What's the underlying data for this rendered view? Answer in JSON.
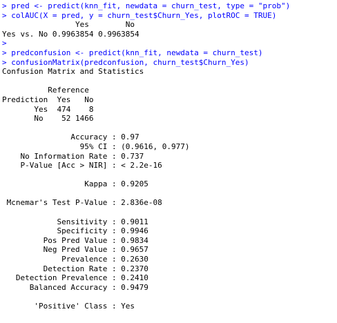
{
  "colors": {
    "command": "#0000ff",
    "output": "#000000",
    "background": "#ffffff"
  },
  "lines": [
    {
      "kind": "cmd",
      "text": "> pred <- predict(knn_fit, newdata = churn_test, type = \"prob\")"
    },
    {
      "kind": "cmd",
      "text": "> colAUC(X = pred, y = churn_test$Churn_Yes, plotROC = TRUE)"
    },
    {
      "kind": "out",
      "text": "                Yes        No"
    },
    {
      "kind": "out",
      "text": "Yes vs. No 0.9963854 0.9963854"
    },
    {
      "kind": "cmd",
      "text": ">"
    },
    {
      "kind": "cmd",
      "text": "> predconfusion <- predict(knn_fit, newdata = churn_test)"
    },
    {
      "kind": "cmd",
      "text": "> confusionMatrix(predconfusion, churn_test$Churn_Yes)"
    },
    {
      "kind": "out",
      "text": "Confusion Matrix and Statistics"
    },
    {
      "kind": "blank",
      "text": ""
    },
    {
      "kind": "out",
      "text": "          Reference"
    },
    {
      "kind": "out",
      "text": "Prediction  Yes   No"
    },
    {
      "kind": "out",
      "text": "       Yes  474    8"
    },
    {
      "kind": "out",
      "text": "       No    52 1466"
    },
    {
      "kind": "blank",
      "text": ""
    },
    {
      "kind": "out",
      "text": "               Accuracy : 0.97"
    },
    {
      "kind": "out",
      "text": "                 95% CI : (0.9616, 0.977)"
    },
    {
      "kind": "out",
      "text": "    No Information Rate : 0.737"
    },
    {
      "kind": "out",
      "text": "    P-Value [Acc > NIR] : < 2.2e-16"
    },
    {
      "kind": "blank",
      "text": ""
    },
    {
      "kind": "out",
      "text": "                  Kappa : 0.9205"
    },
    {
      "kind": "blank",
      "text": ""
    },
    {
      "kind": "out",
      "text": " Mcnemar's Test P-Value : 2.836e-08"
    },
    {
      "kind": "blank",
      "text": ""
    },
    {
      "kind": "out",
      "text": "            Sensitivity : 0.9011"
    },
    {
      "kind": "out",
      "text": "            Specificity : 0.9946"
    },
    {
      "kind": "out",
      "text": "         Pos Pred Value : 0.9834"
    },
    {
      "kind": "out",
      "text": "         Neg Pred Value : 0.9657"
    },
    {
      "kind": "out",
      "text": "             Prevalence : 0.2630"
    },
    {
      "kind": "out",
      "text": "         Detection Rate : 0.2370"
    },
    {
      "kind": "out",
      "text": "   Detection Prevalence : 0.2410"
    },
    {
      "kind": "out",
      "text": "      Balanced Accuracy : 0.9479"
    },
    {
      "kind": "blank",
      "text": ""
    },
    {
      "kind": "out",
      "text": "       'Positive' Class : Yes"
    }
  ]
}
